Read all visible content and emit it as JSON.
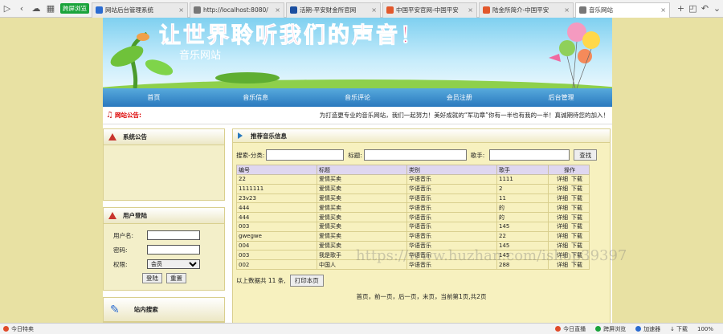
{
  "browser": {
    "switch_label": "跨屏浏览",
    "tabs": [
      {
        "label": "网站后台管理系统",
        "color": "#2a6bd1"
      },
      {
        "label": "http://localhost:8080/",
        "color": "#777777"
      },
      {
        "label": "活期-平安财金所官网",
        "color": "#1b4fa0",
        "badge": "LU"
      },
      {
        "label": "中国平安官网-中国平安",
        "color": "#e2582c"
      },
      {
        "label": "陆金所简介-中国平安",
        "color": "#e2582c"
      },
      {
        "label": "音乐网站",
        "color": "#777777"
      }
    ]
  },
  "banner": {
    "slogan": "让世界聆听我们的声音！",
    "site_name": "音乐网站"
  },
  "nav": [
    "首页",
    "音乐信息",
    "音乐评论",
    "会员注册",
    "后台管理"
  ],
  "notice": {
    "label": "网站公告:",
    "text": "为打造更专业的音乐网站，我们一起努力！美好成就的“军功章”你有一半也有我的一半！真诚期待您的加入！"
  },
  "sidebar": {
    "announcement_title": "系统公告",
    "login": {
      "title": "用户登陆",
      "username_label": "用户名:",
      "password_label": "密码:",
      "role_label": "权限:",
      "role_value": "会员",
      "login_btn": "登陆",
      "reset_btn": "重置"
    },
    "search_title": "站内搜索"
  },
  "main": {
    "title": "推荐音乐信息",
    "search": {
      "category_label": "搜索-分类:",
      "title_label": "标题:",
      "singer_label": "歌手:",
      "button": "查找"
    },
    "columns": [
      "编号",
      "标题",
      "类别",
      "歌手",
      "操作"
    ],
    "rows": [
      [
        "22",
        "爱情买卖",
        "华语音乐",
        "1111"
      ],
      [
        "1111111",
        "爱情买卖",
        "华语音乐",
        "2"
      ],
      [
        "23v23",
        "爱情买卖",
        "华语音乐",
        "11"
      ],
      [
        "444",
        "爱情买卖",
        "华语音乐",
        "的"
      ],
      [
        "444",
        "爱情买卖",
        "华语音乐",
        "的"
      ],
      [
        "003",
        "爱情买卖",
        "华语音乐",
        "145"
      ],
      [
        "gwegwe",
        "爱情买卖",
        "华语音乐",
        "22"
      ],
      [
        "004",
        "爱情买卖",
        "华语音乐",
        "145"
      ],
      [
        "003",
        "我是歌手",
        "华语音乐",
        "145"
      ],
      [
        "002",
        "中国人",
        "华语音乐",
        "288"
      ]
    ],
    "op_detail": "详细",
    "op_download": "下载",
    "total_text": "以上数据共 11 条,",
    "print_btn": "打印本页",
    "pager": "首页，前一页，后一页，末页，当前第1页,共2页"
  },
  "watermark": "https://www.huzhan.com/ishop39397",
  "statusbar": {
    "left": "今日特卖",
    "items": [
      "今日直播",
      "跨屏浏览",
      "加速器",
      "下载"
    ],
    "zoom": "100%"
  }
}
